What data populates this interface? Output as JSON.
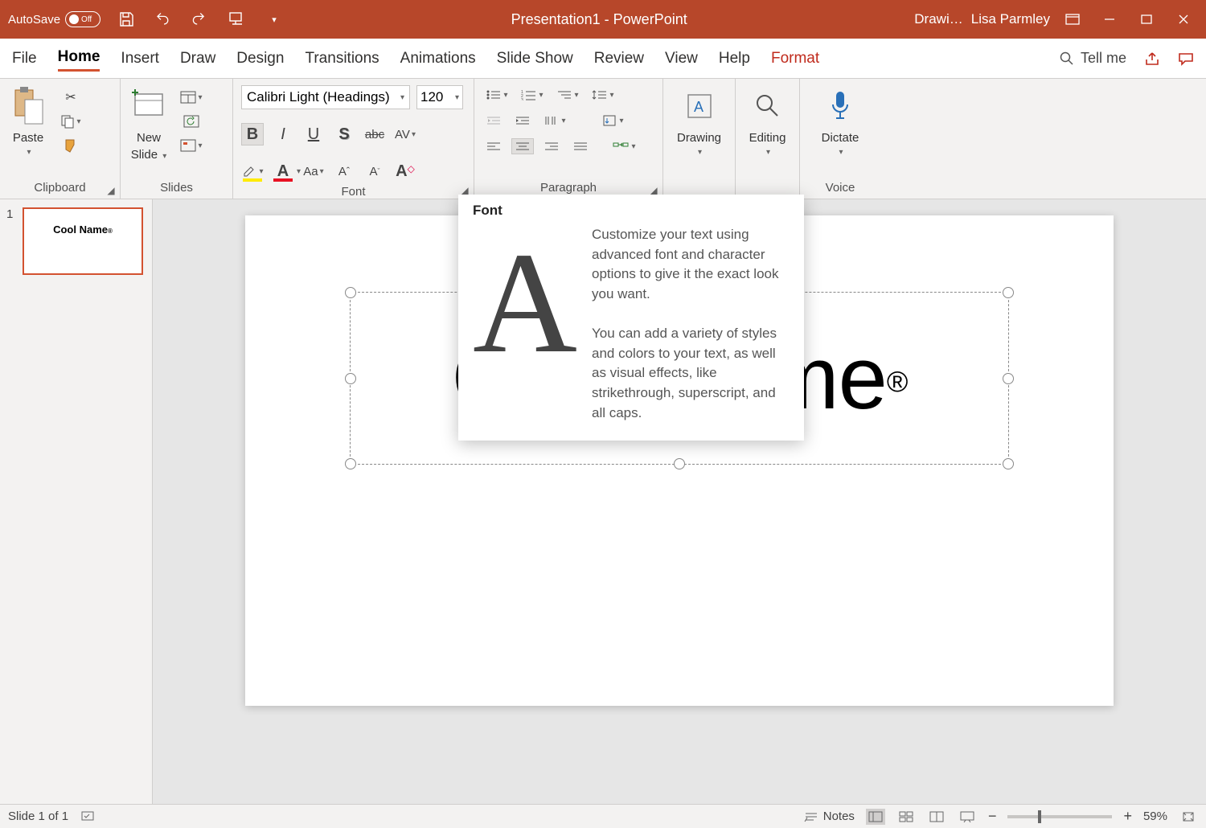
{
  "titlebar": {
    "autosave_label": "AutoSave",
    "autosave_state": "Off",
    "doc_title": "Presentation1  -  PowerPoint",
    "context_tab": "Drawi…",
    "user": "Lisa Parmley"
  },
  "tabs": {
    "file": "File",
    "home": "Home",
    "insert": "Insert",
    "draw": "Draw",
    "design": "Design",
    "transitions": "Transitions",
    "animations": "Animations",
    "slideshow": "Slide Show",
    "review": "Review",
    "view": "View",
    "help": "Help",
    "format": "Format",
    "tell_me": "Tell me"
  },
  "ribbon": {
    "clipboard": {
      "paste": "Paste",
      "label": "Clipboard"
    },
    "slides": {
      "new_slide_l1": "New",
      "new_slide_l2": "Slide",
      "label": "Slides"
    },
    "font": {
      "name": "Calibri Light (Headings)",
      "size": "120",
      "label": "Font"
    },
    "paragraph": {
      "label": "Paragraph"
    },
    "drawing": {
      "btn": "Drawing",
      "label": ""
    },
    "editing": {
      "btn": "Editing",
      "label": ""
    },
    "voice": {
      "btn": "Dictate",
      "label": "Voice"
    }
  },
  "tooltip": {
    "title": "Font",
    "glyph": "A",
    "para1": "Customize your text using advanced font and character options to give it the exact look you want.",
    "para2": "You can add a variety of styles and colors to your text, as well as visual effects, like strikethrough, superscript, and all caps."
  },
  "slide": {
    "thumb_text": "Cool Name",
    "thumb_reg": "®",
    "text": "Cool Name",
    "reg": "®",
    "number": "1"
  },
  "status": {
    "slide_of": "Slide 1 of 1",
    "notes": "Notes",
    "zoom_minus": "−",
    "zoom_plus": "+",
    "zoom_pct": "59%"
  }
}
